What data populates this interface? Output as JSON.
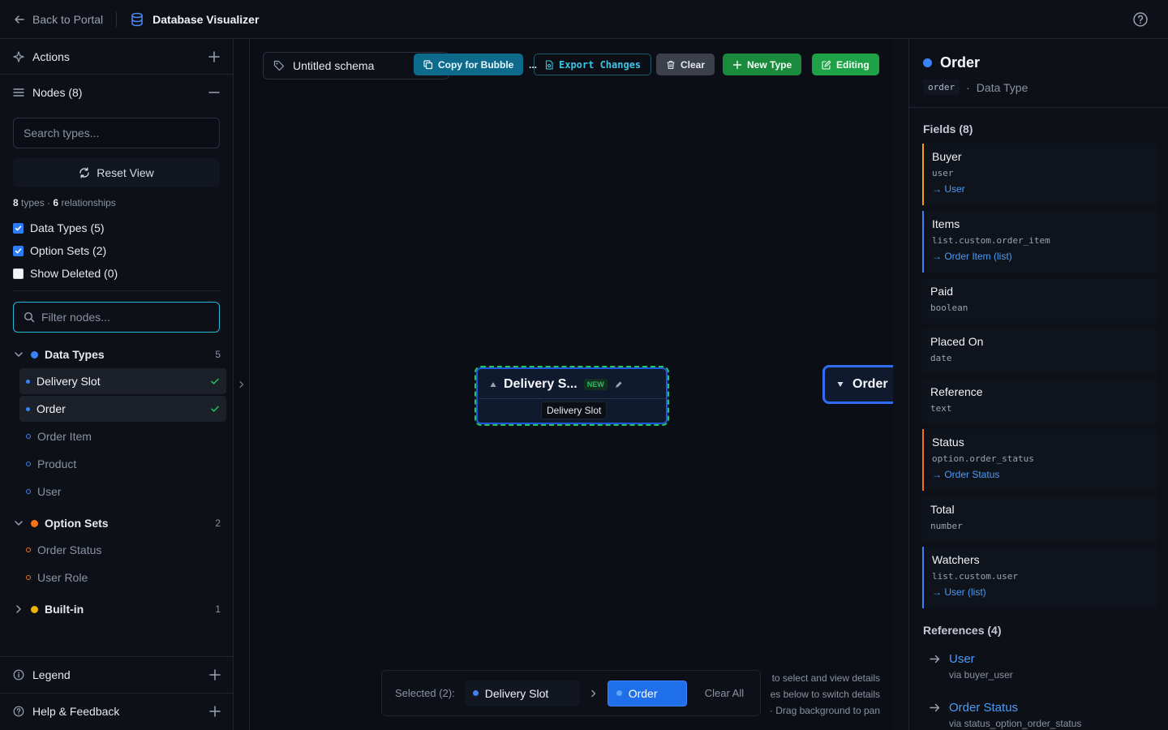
{
  "topbar": {
    "back_label": "Back to Portal",
    "app_title": "Database Visualizer"
  },
  "sidebar": {
    "actions_label": "Actions",
    "nodes_label": "Nodes (8)",
    "search_placeholder": "Search types...",
    "reset_label": "Reset View",
    "counts": {
      "types_num": "8",
      "types_word": "types",
      "sep": "·",
      "rel_num": "6",
      "rel_word": "relationships"
    },
    "checks": [
      {
        "label": "Data Types (5)",
        "checked": true
      },
      {
        "label": "Option Sets (2)",
        "checked": true
      },
      {
        "label": "Show Deleted (0)",
        "checked": false
      }
    ],
    "filter_placeholder": "Filter nodes...",
    "groups": {
      "data_types": {
        "label": "Data Types",
        "count": "5",
        "color": "#3b82f6",
        "items": [
          "Delivery Slot",
          "Order",
          "Order Item",
          "Product",
          "User"
        ]
      },
      "option_sets": {
        "label": "Option Sets",
        "count": "2",
        "color": "#f97316",
        "items": [
          "Order Status",
          "User Role"
        ]
      },
      "built_in": {
        "label": "Built-in",
        "count": "1",
        "color": "#eab308"
      }
    },
    "legend_label": "Legend",
    "help_label": "Help & Feedback"
  },
  "canvas": {
    "schema_name": "Untitled schema",
    "copy_label": "Copy for Bubble",
    "more_label": "...",
    "export_label": "Export Changes",
    "clear_label": "Clear",
    "new_type_label": "New Type",
    "editing_label": "Editing",
    "node_delivery": {
      "title": "Delivery S...",
      "badge": "NEW",
      "tooltip": "Delivery Slot"
    },
    "node_order": {
      "title": "Order"
    },
    "selected": {
      "label": "Selected (2):",
      "chips": [
        "Delivery Slot",
        "Order"
      ],
      "clear_all": "Clear All"
    },
    "hints": [
      "to select and view details",
      "es below to switch details",
      "· Drag background to pan"
    ]
  },
  "details": {
    "title": "Order",
    "code_name": "order",
    "sep": "·",
    "kind": "Data Type",
    "fields_title": "Fields (8)",
    "fields": [
      {
        "name": "Buyer",
        "type": "user",
        "link": "→ User",
        "accent": "#f59e0b"
      },
      {
        "name": "Items",
        "type": "list.custom.order_item",
        "link": "→ Order Item (list)",
        "accent": "#3b82f6"
      },
      {
        "name": "Paid",
        "type": "boolean"
      },
      {
        "name": "Placed On",
        "type": "date"
      },
      {
        "name": "Reference",
        "type": "text"
      },
      {
        "name": "Status",
        "type": "option.order_status",
        "link": "→ Order Status",
        "accent": "#f97316"
      },
      {
        "name": "Total",
        "type": "number"
      },
      {
        "name": "Watchers",
        "type": "list.custom.user",
        "link": "→ User (list)",
        "accent": "#3b82f6"
      }
    ],
    "refs_title": "References (4)",
    "refs": [
      {
        "name": "User",
        "via": "via buyer_user"
      },
      {
        "name": "Order Status",
        "via": "via status_option_order_status"
      }
    ]
  }
}
